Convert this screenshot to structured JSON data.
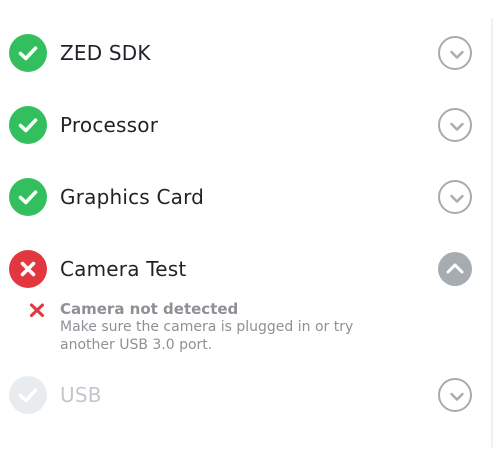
{
  "checks": [
    {
      "id": "zed-sdk",
      "label": "ZED SDK",
      "status": "passed",
      "expanded": false
    },
    {
      "id": "processor",
      "label": "Processor",
      "status": "passed",
      "expanded": false
    },
    {
      "id": "graphics-card",
      "label": "Graphics Card",
      "status": "passed",
      "expanded": false
    },
    {
      "id": "camera-test",
      "label": "Camera Test",
      "status": "failed",
      "expanded": true
    },
    {
      "id": "usb",
      "label": "USB",
      "status": "pending",
      "expanded": false
    }
  ],
  "camera_detail": {
    "title": "Camera not detected",
    "message": "Make sure the camera is plugged in or try another USB 3.0 port.",
    "icon": "cross-icon"
  },
  "icons": {
    "passed": "checkmark-icon",
    "failed": "cross-icon",
    "pending": "checkmark-icon",
    "collapsed_toggle": "chevron-down-icon",
    "expanded_toggle": "chevron-up-icon"
  },
  "colors": {
    "passed": "#34bf5e",
    "failed": "#e2373f",
    "pending": "#e9ecef",
    "toggle": "#a7acb1",
    "label": "#1f2328",
    "muted_label": "#c3c7cc",
    "detail_text": "#8d9195"
  }
}
